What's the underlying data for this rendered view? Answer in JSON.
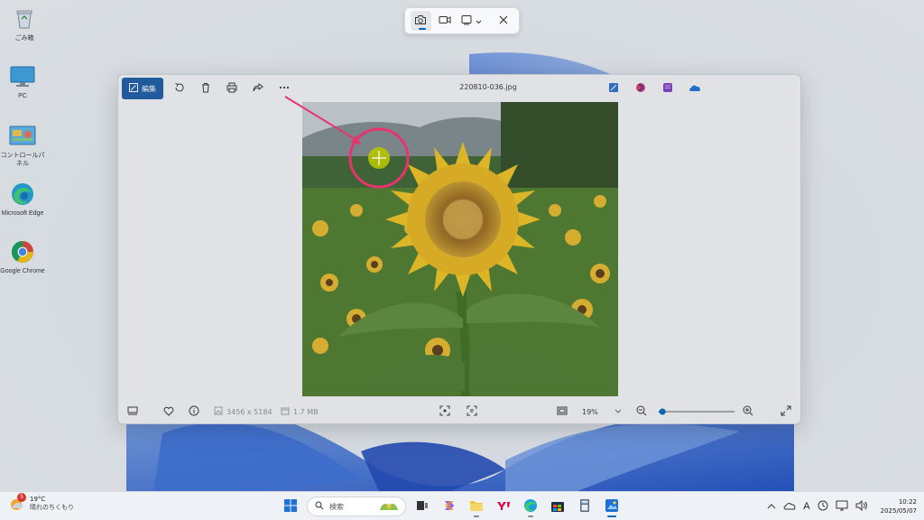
{
  "desktop": {
    "icons": [
      {
        "label": "ごみ箱",
        "icon": "recycle-bin-icon"
      },
      {
        "label": "PC",
        "icon": "pc-monitor-icon"
      },
      {
        "label": "コントロールパネル",
        "icon": "control-panel-icon"
      },
      {
        "label": "Microsoft Edge",
        "icon": "edge-icon"
      },
      {
        "label": "Google Chrome",
        "icon": "chrome-icon"
      }
    ]
  },
  "snipping_toolbar": {
    "modes": [
      {
        "name": "screenshot-mode",
        "icon": "camera-icon",
        "active": true
      },
      {
        "name": "video-mode",
        "icon": "video-camera-icon",
        "active": false
      },
      {
        "name": "snip-shape",
        "icon": "rectangle-snip-icon",
        "active": false
      }
    ],
    "close_icon": "close-icon"
  },
  "photos": {
    "edit_label": "編集",
    "file_name": "220810-036.jpg",
    "toolbar_icons": [
      "rotate-icon",
      "delete-icon",
      "print-icon",
      "share-icon",
      "more-icon"
    ],
    "right_icons": [
      "image-editor-icon",
      "clipchamp-icon",
      "designer-icon",
      "onedrive-icon"
    ],
    "footer": {
      "dimensions": "3456 x 5184",
      "file_size": "1.7 MB",
      "zoom": "19%",
      "zoom_fraction": 0.05
    }
  },
  "taskbar": {
    "weather": {
      "temp": "19°C",
      "condition": "晴れのちくもり",
      "badge": "5"
    },
    "search_label": "検索",
    "clock": {
      "time": "10:22",
      "date": "2025/05/07"
    },
    "ime": "A"
  },
  "colors": {
    "accent": "#0067c0",
    "annotation": "#e8336f",
    "cursor_dot": "#b7c400"
  }
}
